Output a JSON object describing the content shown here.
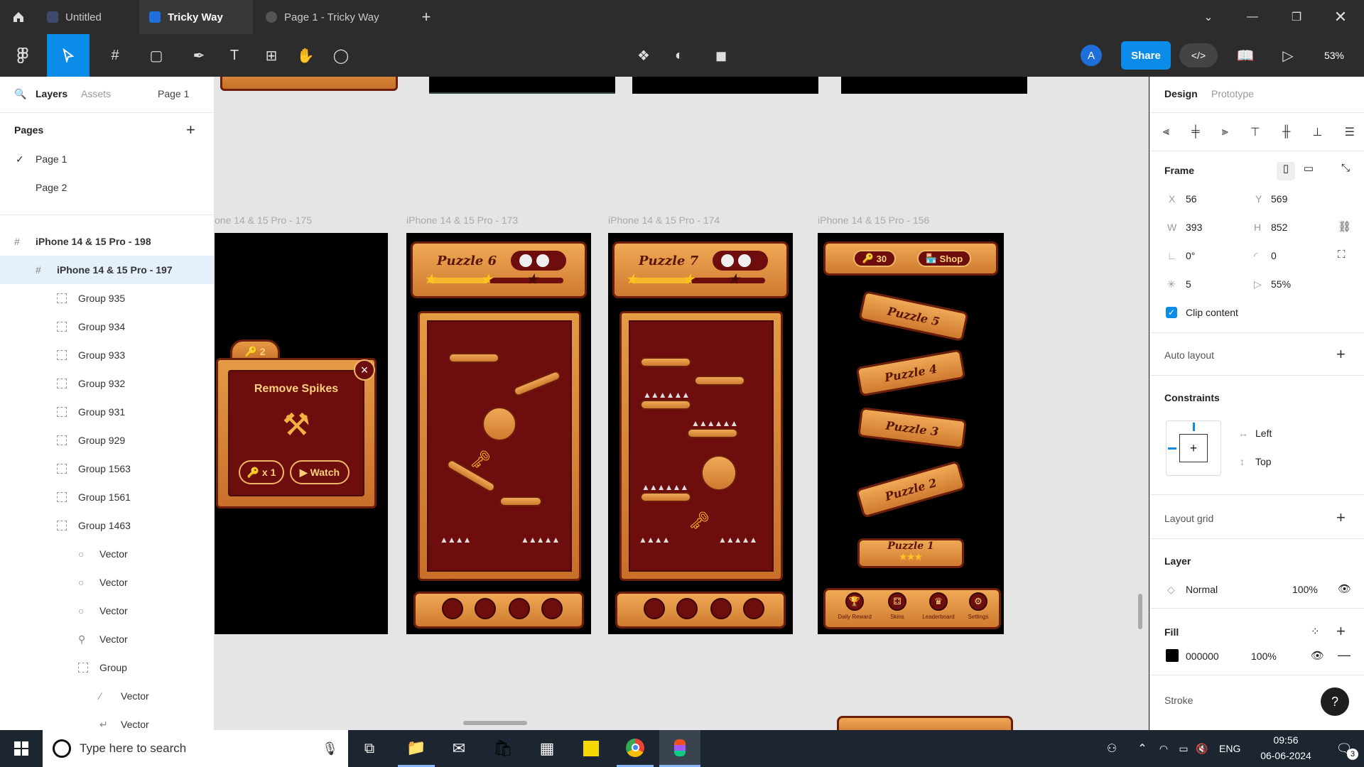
{
  "tabs": {
    "home_icon": "home-icon",
    "items": [
      {
        "label": "Untitled"
      },
      {
        "label": "Tricky Way"
      },
      {
        "label": "Page 1 - Tricky Way"
      }
    ],
    "add": "+"
  },
  "toolbar": {
    "avatar": "A",
    "share": "Share",
    "zoom": "53%"
  },
  "left": {
    "tabs": {
      "layers": "Layers",
      "assets": "Assets",
      "page": "Page 1"
    },
    "pages_title": "Pages",
    "add": "+",
    "pages": [
      "Page 1",
      "Page 2"
    ],
    "layers": [
      {
        "label": "iPhone 14 & 15 Pro - 198"
      },
      {
        "label": "iPhone 14 & 15 Pro - 197"
      },
      {
        "label": "Group 935"
      },
      {
        "label": "Group 934"
      },
      {
        "label": "Group 933"
      },
      {
        "label": "Group 932"
      },
      {
        "label": "Group 931"
      },
      {
        "label": "Group 929"
      },
      {
        "label": "Group 1563"
      },
      {
        "label": "Group 1561"
      },
      {
        "label": "Group 1463"
      },
      {
        "label": "Vector"
      },
      {
        "label": "Vector"
      },
      {
        "label": "Vector"
      },
      {
        "label": "Vector"
      },
      {
        "label": "Group"
      },
      {
        "label": "Vector"
      },
      {
        "label": "Vector"
      }
    ]
  },
  "canvas": {
    "frame_labels": [
      "one 14 & 15 Pro - 175",
      "iPhone 14 & 15 Pro - 173",
      "iPhone 14 & 15 Pro - 174",
      "iPhone 14 & 15 Pro - 156"
    ],
    "f175": {
      "keys": "2",
      "title": "Remove Spikes",
      "btn1": "x 1",
      "btn2": "Watch",
      "close": "×"
    },
    "f173": {
      "title": "Puzzle 6"
    },
    "f174": {
      "title": "Puzzle 7"
    },
    "f156": {
      "keys": "30",
      "shop": "Shop",
      "puzzles": [
        "Puzzle 5",
        "Puzzle 4",
        "Puzzle 3",
        "Puzzle 2",
        "Puzzle 1"
      ],
      "stars": "★★★",
      "nav": [
        "Daily Reward",
        "Skins",
        "Leaderboard",
        "Settings"
      ]
    }
  },
  "right": {
    "tabs": {
      "design": "Design",
      "prototype": "Prototype"
    },
    "frame": "Frame",
    "x_label": "X",
    "x": "56",
    "y_label": "Y",
    "y": "569",
    "w_label": "W",
    "w": "393",
    "h_label": "H",
    "h": "852",
    "rotation": "0°",
    "radius": "0",
    "count": "5",
    "percent": "55%",
    "clip": "Clip content",
    "auto_layout": "Auto layout",
    "constraints": "Constraints",
    "c_h": "Left",
    "c_v": "Top",
    "layout_grid": "Layout grid",
    "layer": "Layer",
    "blend": "Normal",
    "opacity": "100%",
    "fill": "Fill",
    "fill_hex": "000000",
    "fill_opacity": "100%",
    "stroke": "Stroke",
    "help": "?"
  },
  "taskbar": {
    "search": "Type here to search",
    "lang": "ENG",
    "time": "09:56",
    "date": "06-06-2024",
    "notif": "3"
  }
}
